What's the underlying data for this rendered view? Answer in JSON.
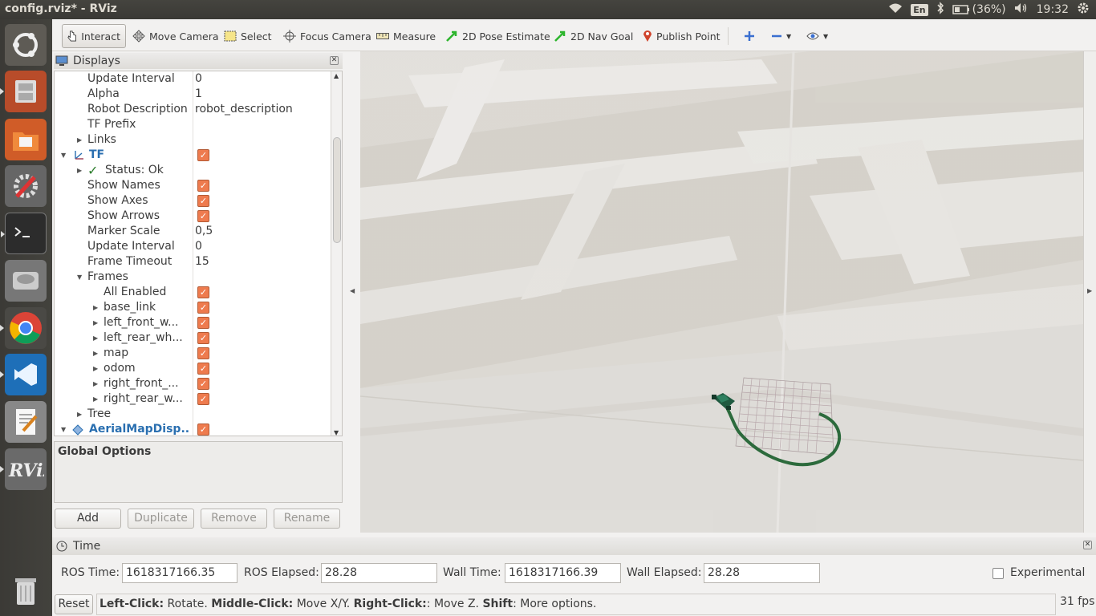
{
  "window_title": "config.rviz* - RViz",
  "tray": {
    "lang": "En",
    "battery": "(36%)",
    "clock": "19:32"
  },
  "toolbar": {
    "interact": "Interact",
    "move_camera": "Move Camera",
    "select": "Select",
    "focus_camera": "Focus Camera",
    "measure": "Measure",
    "pose_estimate": "2D Pose Estimate",
    "nav_goal": "2D Nav Goal",
    "publish_point": "Publish Point"
  },
  "displays": {
    "title": "Displays",
    "rows": [
      {
        "label": "Update Interval",
        "value": "0"
      },
      {
        "label": "Alpha",
        "value": "1"
      },
      {
        "label": "Robot Description",
        "value": "robot_description"
      },
      {
        "label": "TF Prefix",
        "value": ""
      },
      {
        "label": "Links",
        "value": ""
      },
      {
        "label": "TF",
        "value": ""
      },
      {
        "label": "Status: Ok",
        "value": ""
      },
      {
        "label": "Show Names",
        "value": ""
      },
      {
        "label": "Show Axes",
        "value": ""
      },
      {
        "label": "Show Arrows",
        "value": ""
      },
      {
        "label": "Marker Scale",
        "value": "0,5"
      },
      {
        "label": "Update Interval",
        "value": "0"
      },
      {
        "label": "Frame Timeout",
        "value": "15"
      },
      {
        "label": "Frames",
        "value": ""
      },
      {
        "label": "All Enabled",
        "value": ""
      },
      {
        "label": "base_link",
        "value": ""
      },
      {
        "label": "left_front_w...",
        "value": ""
      },
      {
        "label": "left_rear_wh...",
        "value": ""
      },
      {
        "label": "map",
        "value": ""
      },
      {
        "label": "odom",
        "value": ""
      },
      {
        "label": "right_front_...",
        "value": ""
      },
      {
        "label": "right_rear_w...",
        "value": ""
      },
      {
        "label": "Tree",
        "value": ""
      },
      {
        "label": "AerialMapDisp...",
        "value": ""
      }
    ],
    "global_options": "Global Options",
    "buttons": {
      "add": "Add",
      "duplicate": "Duplicate",
      "remove": "Remove",
      "rename": "Rename"
    }
  },
  "time": {
    "title": "Time",
    "ros_time_label": "ROS Time:",
    "ros_time": "1618317166.35",
    "ros_elapsed_label": "ROS Elapsed:",
    "ros_elapsed": "28.28",
    "wall_time_label": "Wall Time:",
    "wall_time": "1618317166.39",
    "wall_elapsed_label": "Wall Elapsed:",
    "wall_elapsed": "28.28",
    "experimental": "Experimental"
  },
  "status": {
    "reset": "Reset",
    "left_click": "Left-Click:",
    "left_desc": " Rotate. ",
    "middle_click": "Middle-Click:",
    "middle_desc": " Move X/Y. ",
    "right_click": "Right-Click:",
    "right_desc": ": Move Z. ",
    "shift": "Shift",
    "shift_desc": ": More options.",
    "fps": "31 fps"
  },
  "colors": {
    "accent": "#ee7b4e",
    "tf_blue": "#2a6fb0",
    "path_green": "#2c6a3c"
  }
}
